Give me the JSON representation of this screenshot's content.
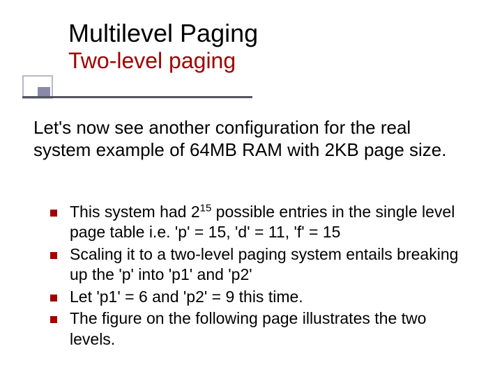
{
  "title": {
    "main": "Multilevel Paging",
    "sub": "Two-level paging"
  },
  "body": "Let's now see another configuration for the real system example of 64MB RAM with 2KB page size.",
  "bullets": [
    "This system had 2<sup>15</sup> possible entries in the single level page table i.e. 'p' = 15, 'd' = 11, 'f' = 15",
    "Scaling it to a two-level paging system entails breaking up the 'p' into 'p1' and 'p2'",
    "Let 'p1' = 6 and 'p2' = 9 this time.",
    "The figure on the following page illustrates the two levels."
  ]
}
